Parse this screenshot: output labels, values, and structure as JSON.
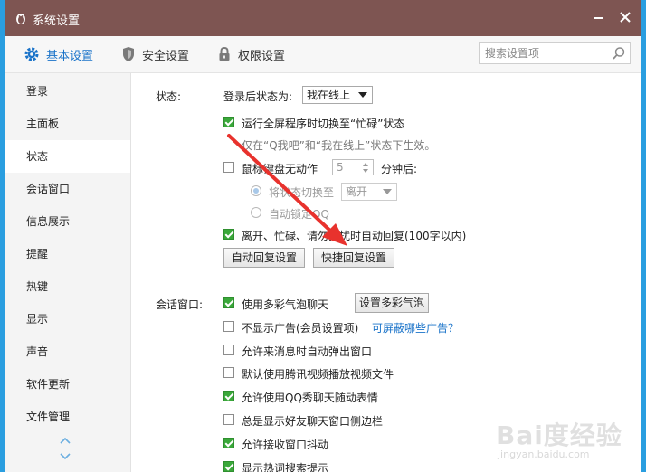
{
  "window": {
    "title": "系统设置"
  },
  "tabs": [
    {
      "label": "基本设置",
      "icon": "gear-icon"
    },
    {
      "label": "安全设置",
      "icon": "shield-icon"
    },
    {
      "label": "权限设置",
      "icon": "lock-icon"
    }
  ],
  "search": {
    "placeholder": "搜索设置项"
  },
  "sidebar": {
    "items": [
      "登录",
      "主面板",
      "状态",
      "会话窗口",
      "信息展示",
      "提醒",
      "热键",
      "显示",
      "声音",
      "软件更新",
      "文件管理"
    ],
    "active_index": 2
  },
  "status": {
    "section_label": "状态:",
    "after_login_label": "登录后状态为:",
    "after_login_value": "我在线上",
    "fullscreen_busy": {
      "label": "运行全屏程序时切换至“忙碌”状态",
      "checked": true
    },
    "fullscreen_hint": "仅在“Q我吧”和“我在线上”状态下生效。",
    "idle": {
      "label": "鼠标键盘无动作",
      "checked": false,
      "minutes": "5",
      "suffix": "分钟后:"
    },
    "idle_switch": {
      "label": "将状态切换至",
      "value": "离开",
      "selected": true
    },
    "idle_lock": {
      "label": "自动锁定QQ",
      "selected": false
    },
    "auto_reply": {
      "label": "离开、忙碌、请勿打扰时自动回复(100字以内)",
      "checked": true
    },
    "buttons": {
      "auto_reply_settings": "自动回复设置",
      "quick_reply_settings": "快捷回复设置"
    }
  },
  "chat_window": {
    "section_label": "会话窗口:",
    "options": [
      {
        "label": "使用多彩气泡聊天",
        "checked": true
      },
      {
        "label": "不显示广告(会员设置项)",
        "checked": false
      },
      {
        "label": "允许来消息时自动弹出窗口",
        "checked": false
      },
      {
        "label": "默认使用腾讯视频播放视频文件",
        "checked": false
      },
      {
        "label": "允许使用QQ秀聊天随动表情",
        "checked": true
      },
      {
        "label": "总是显示好友聊天窗口侧边栏",
        "checked": false
      },
      {
        "label": "允许接收窗口抖动",
        "checked": true
      },
      {
        "label": "显示热词搜索提示",
        "checked": true
      }
    ],
    "bubble_button": "设置多彩气泡",
    "ad_link": "可屏蔽哪些广告？"
  },
  "watermark": {
    "logo": "Bai度经验",
    "url": "jingyan.baidu.com"
  },
  "colors": {
    "titlebar": "#7e5552",
    "accent": "#1a73c9",
    "check_green": "#3aa83a",
    "arrow_red": "#e8322d"
  }
}
